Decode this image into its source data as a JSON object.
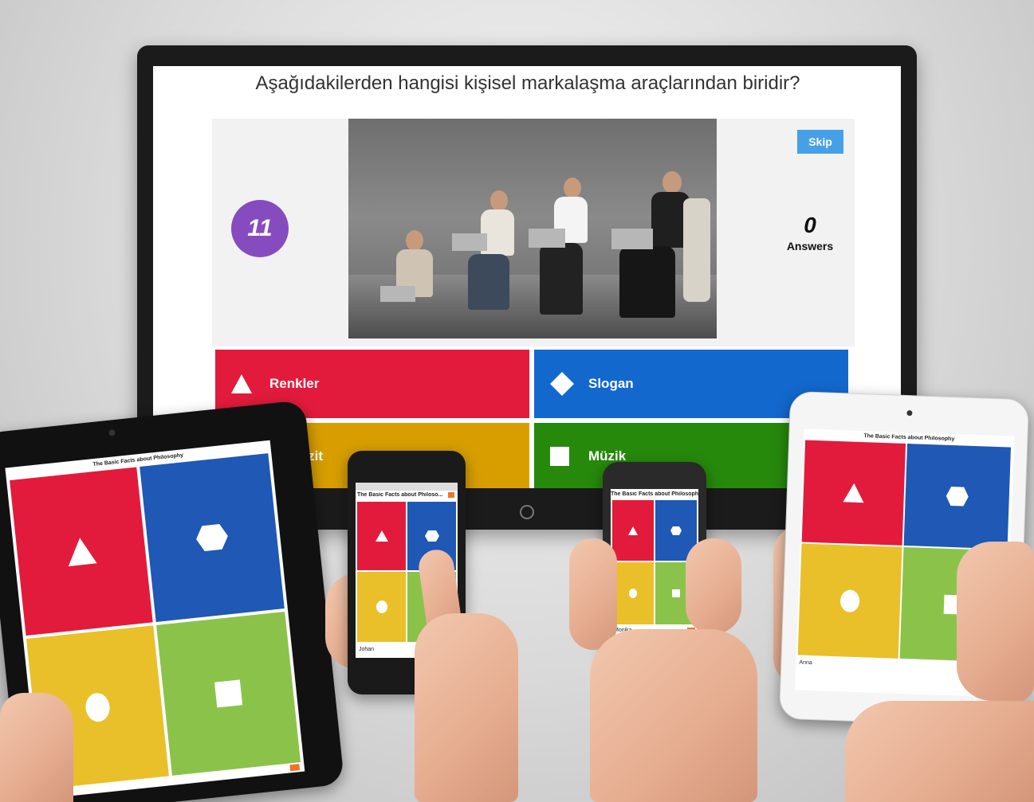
{
  "quiz": {
    "question": "Aşağıdakilerden hangisi kişisel markalaşma araçlarından biridir?",
    "timer": "11",
    "skip_label": "Skip",
    "answer_count": "0",
    "answers_label": "Answers",
    "options": [
      {
        "label": "Renkler",
        "color": "#e21b3c",
        "shape": "triangle"
      },
      {
        "label": "Slogan",
        "color": "#1368ce",
        "shape": "diamond"
      },
      {
        "label": "Kartvizit",
        "color": "#d89e00",
        "shape": "circle"
      },
      {
        "label": "Müzik",
        "color": "#26890c",
        "shape": "square"
      }
    ]
  },
  "devices": {
    "game_title": "The Basic Facts about Philosophy",
    "phone1_title": "The Basic Facts about Philoso...",
    "phone1_player": "Johan",
    "phone2_player": "Monika",
    "tablet_right_player": "Anna",
    "tile_colors": {
      "red": "#e21b3c",
      "blue": "#1f58b5",
      "yellow": "#e9c02a",
      "green": "#8bc34a"
    }
  }
}
